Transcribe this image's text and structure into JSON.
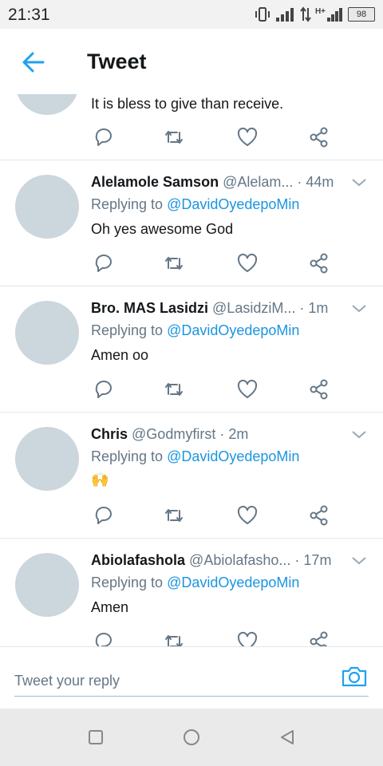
{
  "status_bar": {
    "time": "21:31",
    "network": "H+",
    "battery": "98"
  },
  "header": {
    "title": "Tweet"
  },
  "tweets": [
    {
      "text": "It is bless to give than receive."
    },
    {
      "name": "Alelamole Samson",
      "handle": "@Alelam...",
      "time": "· 44m",
      "replying_label": "Replying to",
      "reply_to": "@DavidOyedepoMin",
      "text": "Oh yes awesome God"
    },
    {
      "name": "Bro. MAS Lasidzi",
      "handle": "@LasidziM...",
      "time": "· 1m",
      "replying_label": "Replying to",
      "reply_to": "@DavidOyedepoMin",
      "text": "Amen oo"
    },
    {
      "name": "Chris",
      "handle": "@Godmyfirst",
      "time": "· 2m",
      "replying_label": "Replying to",
      "reply_to": "@DavidOyedepoMin",
      "text": "🙌"
    },
    {
      "name": "Abiolafashola",
      "handle": "@Abiolafasho...",
      "time": "· 17m",
      "replying_label": "Replying to",
      "reply_to": "@DavidOyedepoMin",
      "text": "Amen"
    }
  ],
  "reply_bar": {
    "placeholder": "Tweet your reply"
  },
  "colors": {
    "accent": "#1da1f2",
    "mention": "#1b95e0",
    "secondary_text": "#657786",
    "avatar_placeholder": "#ccd6dd"
  },
  "icons": {
    "back": "arrow-left-icon",
    "reply": "speech-bubble-icon",
    "retweet": "retweet-icon",
    "like": "heart-icon",
    "share": "share-icon",
    "caret": "chevron-down-icon",
    "camera": "camera-icon"
  }
}
